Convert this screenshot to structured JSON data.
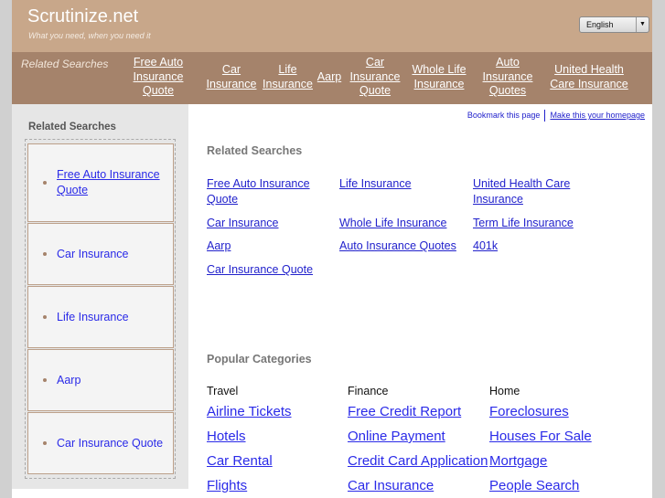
{
  "header": {
    "title": "Scrutinize.net",
    "tagline": "What you need, when you need it",
    "language": "English"
  },
  "nav": {
    "label": "Related Searches",
    "items": [
      "Free Auto Insurance Quote",
      "Car Insurance",
      "Life Insurance",
      "Aarp",
      "Car Insurance Quote",
      "Whole Life Insurance",
      "Auto Insurance Quotes",
      "United Health Care Insurance"
    ]
  },
  "sidebar": {
    "title": "Related Searches",
    "items": [
      "Free Auto Insurance Quote",
      "Car Insurance",
      "Life Insurance",
      "Aarp",
      "Car Insurance Quote"
    ]
  },
  "toplinks": {
    "bookmark": "Bookmark this page",
    "homepage": "Make this your homepage"
  },
  "related": {
    "title": "Related Searches",
    "items": [
      "Free Auto Insurance Quote",
      "Life Insurance",
      "United Health Care Insurance",
      "Car Insurance",
      "Whole Life Insurance",
      "Term Life Insurance",
      "Aarp",
      "Auto Insurance Quotes",
      "401k",
      "Car Insurance Quote"
    ]
  },
  "popular": {
    "title": "Popular Categories",
    "columns": [
      {
        "heading": "Travel",
        "links": [
          "Airline Tickets",
          "Hotels",
          "Car Rental",
          "Flights"
        ]
      },
      {
        "heading": "Finance",
        "links": [
          "Free Credit Report",
          "Online Payment",
          "Credit Card Application",
          "Car Insurance"
        ]
      },
      {
        "heading": "Home",
        "links": [
          "Foreclosures",
          "Houses For Sale",
          "Mortgage",
          "People Search"
        ]
      }
    ]
  }
}
